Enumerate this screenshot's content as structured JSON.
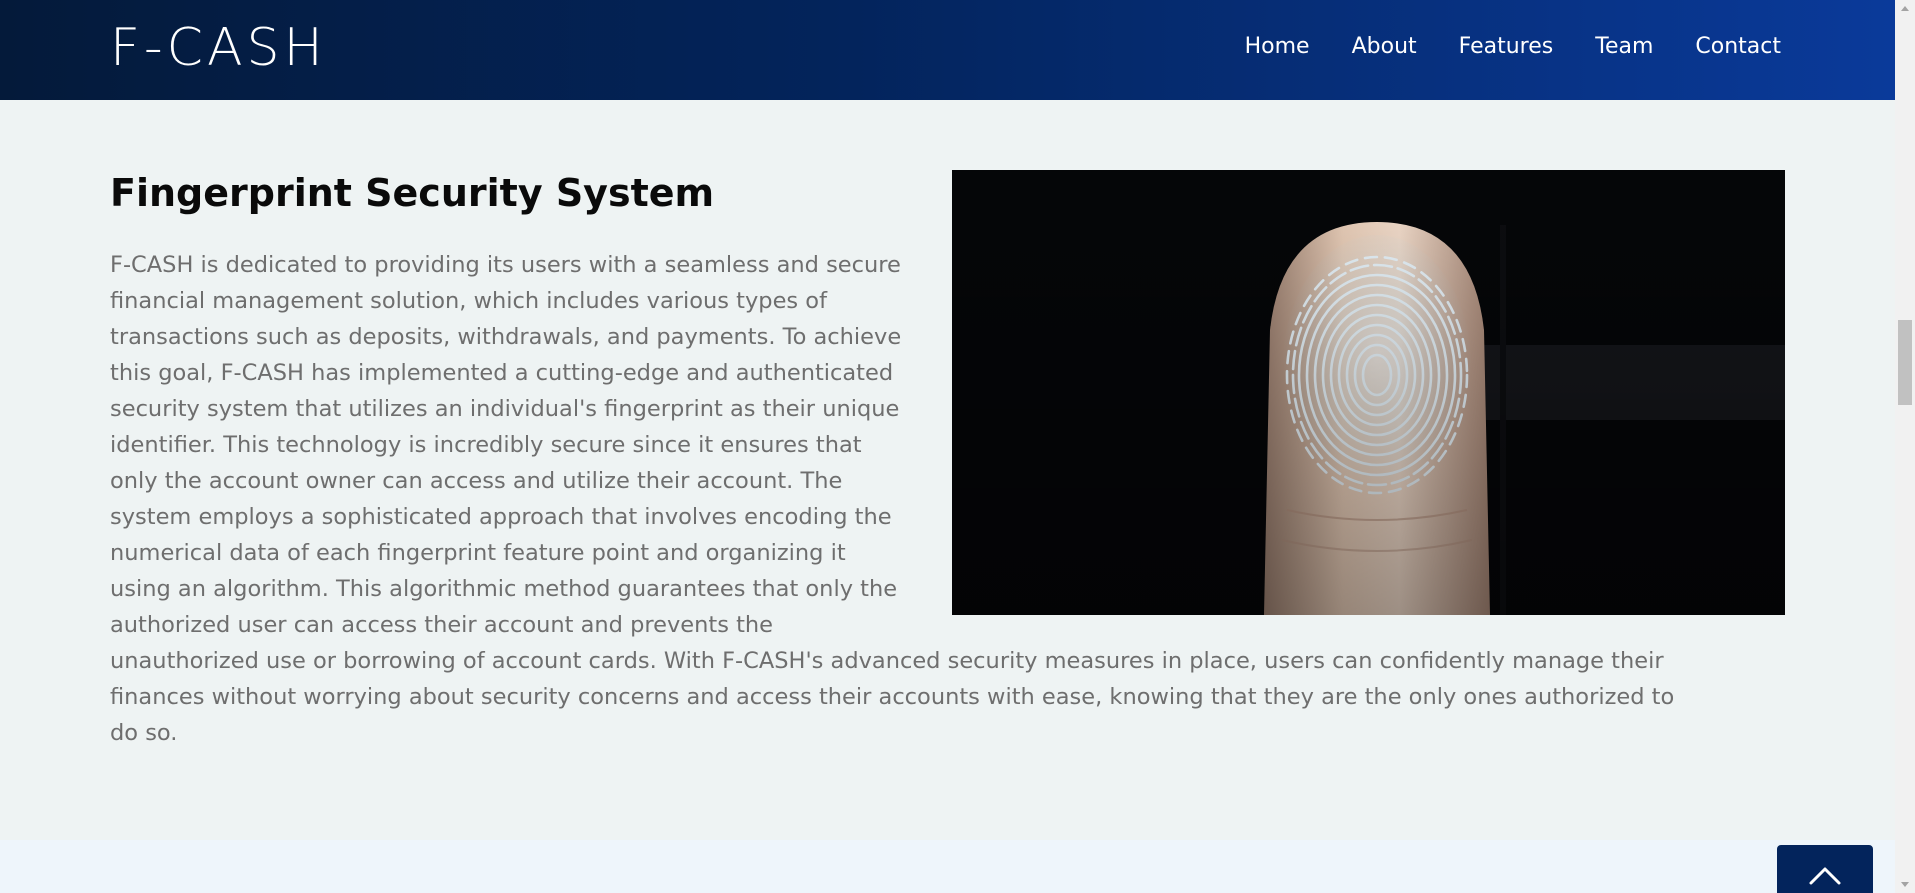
{
  "brand": {
    "name": "F-CASH"
  },
  "nav": {
    "items": [
      {
        "label": "Home"
      },
      {
        "label": "About"
      },
      {
        "label": "Features"
      },
      {
        "label": "Team"
      },
      {
        "label": "Contact"
      }
    ]
  },
  "section": {
    "title": "Fingerprint Security System",
    "body": "F-CASH is dedicated to providing its users with a seamless and secure financial management solution, which includes various types of transactions such as deposits, withdrawals, and payments. To achieve this goal, F-CASH has implemented a cutting-edge and authenticated security system that utilizes an individual's fingerprint as their unique identifier. This technology is incredibly secure since it ensures that only the account owner can access and utilize their account. The system employs a sophisticated approach that involves encoding the numerical data of each fingerprint feature point and organizing it using an algorithm. This algorithmic method guarantees that only the authorized user can access their account and prevents the unauthorized use or borrowing of account cards. With F-CASH's advanced security measures in place, users can confidently manage their finances without worrying about security concerns and access their accounts with ease, knowing that they are the only ones authorized to do so."
  },
  "image": {
    "subject": "fingerprint-on-finger-image"
  },
  "back_to_top": {
    "icon": "chevron-up-icon"
  },
  "colors": {
    "nav_dark": "#041a3a",
    "nav_light": "#0a3a9a",
    "page_bg": "#eef3f3",
    "body_text": "#6e6e6e",
    "button": "#03245c"
  }
}
